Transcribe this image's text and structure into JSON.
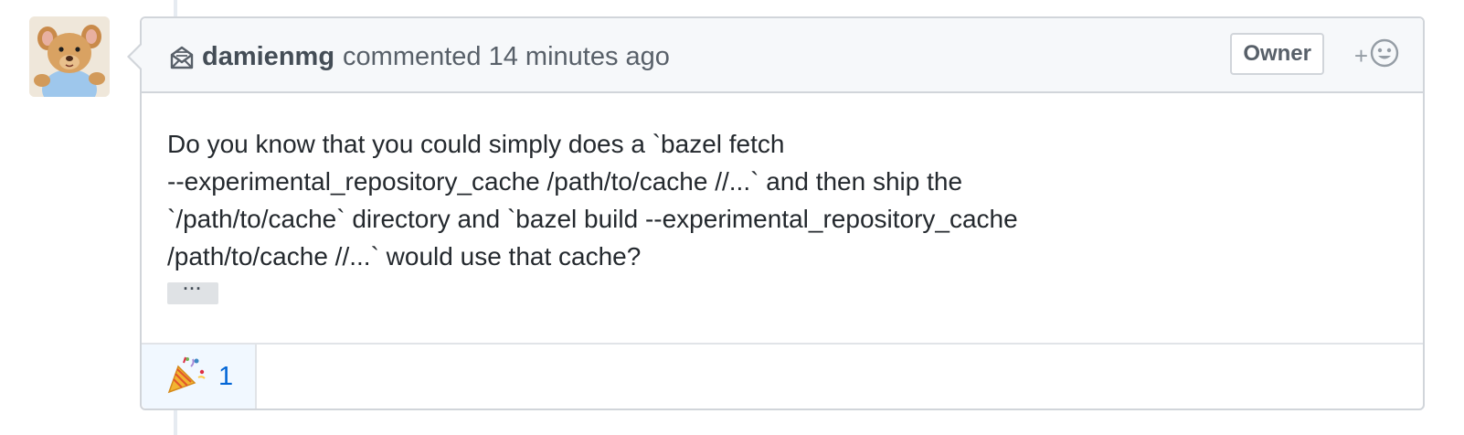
{
  "comment": {
    "author": "damienmg",
    "action": "commented",
    "time": "14 minutes ago",
    "badge": "Owner",
    "reaction_plus": "+",
    "body_lines": [
      "Do you know that you could simply does a `bazel fetch",
      "--experimental_repository_cache /path/to/cache //...` and then ship the",
      "`/path/to/cache` directory and `bazel build --experimental_repository_cache",
      "/path/to/cache //...` would use that cache?"
    ],
    "ellipsis_label": "···",
    "reactions": [
      {
        "icon": "tada-icon",
        "count": "1"
      }
    ]
  },
  "colors": {
    "border": "#d1d5da",
    "header_bg": "#f6f8fa",
    "link": "#0366d6",
    "reaction_bg": "#f1f8ff"
  }
}
